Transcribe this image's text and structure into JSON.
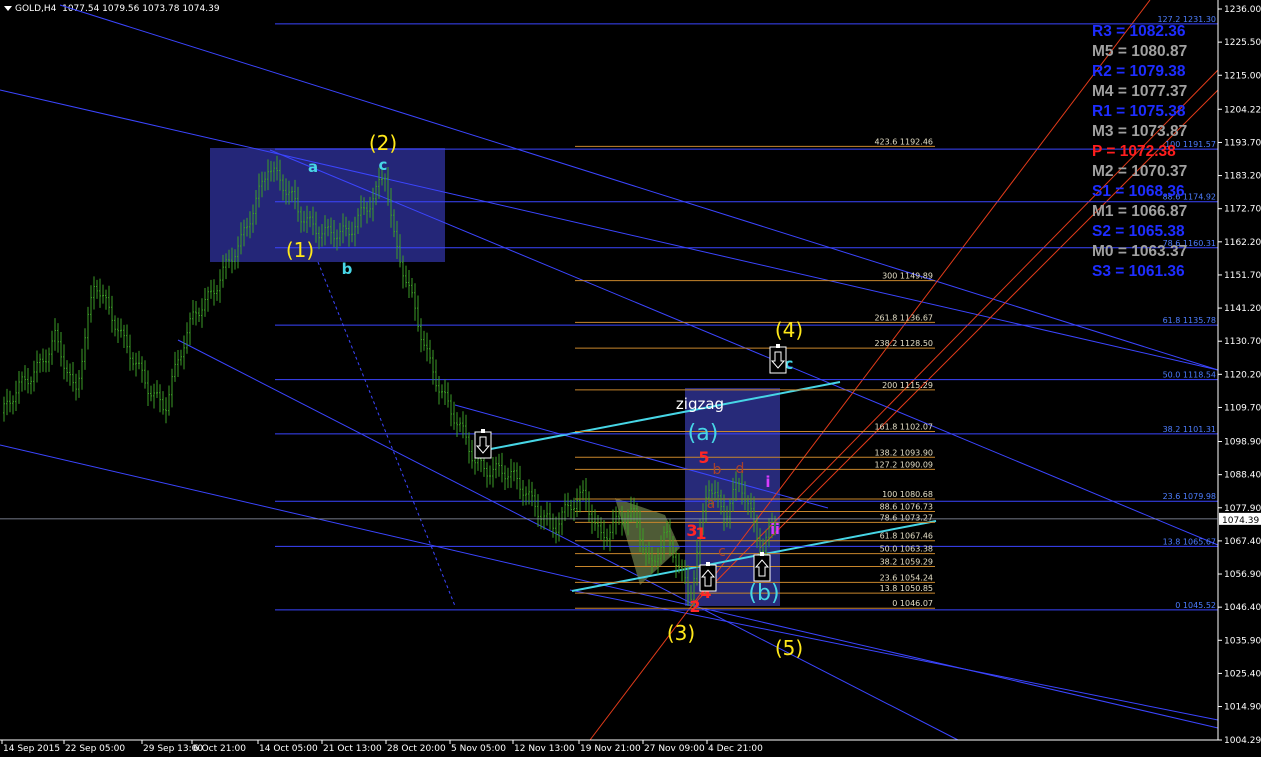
{
  "header": {
    "symbol": "GOLD,H4",
    "ohlc": "1077.54 1079.56 1073.78 1074.39"
  },
  "colors": {
    "background": "#000000",
    "candle": "#3c9d27",
    "trendline": "#3b45ff",
    "fibo": "#c8862c",
    "channel": "#e23b1a",
    "cyan": "#47d6e6",
    "yellow": "#ffe81a",
    "red": "#ff2626",
    "magenta": "#d83cff"
  },
  "chart_data": {
    "type": "candlestick",
    "title": "GOLD,H4",
    "current_price": "1074.39",
    "yaxis": {
      "min": 1004.29,
      "max": 1236.0,
      "ticks": [
        "1236.00",
        "1225.50",
        "1215.00",
        "1204.22",
        "1193.70",
        "1183.20",
        "1172.70",
        "1162.20",
        "1151.70",
        "1141.20",
        "1130.70",
        "1120.20",
        "1109.70",
        "1098.90",
        "1088.40",
        "1077.90",
        "1067.40",
        "1056.90",
        "1046.40",
        "1035.90",
        "1025.40",
        "1014.90",
        "1004.29"
      ]
    },
    "xaxis": {
      "ticks": [
        "14 Sep 2015",
        "22 Sep 05:00",
        "29 Sep 13:00",
        "6 Oct 21:00",
        "14 Oct 05:00",
        "21 Oct 13:00",
        "28 Oct 20:00",
        "5 Nov 05:00",
        "12 Nov 13:00",
        "19 Nov 21:00",
        "27 Nov 09:00",
        "4 Dec 21:00"
      ]
    },
    "pivots": [
      {
        "label": "R3 = 1082.36",
        "color": "#1e2dff"
      },
      {
        "label": "M5 = 1080.87",
        "color": "#a0a0a0"
      },
      {
        "label": "R2 = 1079.38",
        "color": "#1e2dff"
      },
      {
        "label": "M4 = 1077.37",
        "color": "#a0a0a0"
      },
      {
        "label": "R1 = 1075.38",
        "color": "#1e2dff"
      },
      {
        "label": "M3 = 1073.87",
        "color": "#a0a0a0"
      },
      {
        "label": "P = 1072.38",
        "color": "#ff1e1e"
      },
      {
        "label": "M2 = 1070.37",
        "color": "#a0a0a0"
      },
      {
        "label": "S1 = 1068.36",
        "color": "#1e2dff"
      },
      {
        "label": "M1 = 1066.87",
        "color": "#a0a0a0"
      },
      {
        "label": "S2 = 1065.38",
        "color": "#1e2dff"
      },
      {
        "label": "M0 = 1063.37",
        "color": "#a0a0a0"
      },
      {
        "label": "S3 = 1061.36",
        "color": "#1e2dff"
      }
    ],
    "fibo_blue": [
      {
        "label": "127.2 1231.30",
        "price": 1231.3
      },
      {
        "label": "100 1191.57",
        "price": 1191.57
      },
      {
        "label": "88.6 1174.92",
        "price": 1174.92
      },
      {
        "label": "78.6 1160.31",
        "price": 1160.31
      },
      {
        "label": "61.8 1135.78",
        "price": 1135.78
      },
      {
        "label": "50.0 1118.54",
        "price": 1118.54
      },
      {
        "label": "38.2 1101.31",
        "price": 1101.31
      },
      {
        "label": "23.6 1079.98",
        "price": 1079.98
      },
      {
        "label": "13.8 1065.67",
        "price": 1065.67
      },
      {
        "label": "0 1045.52",
        "price": 1045.52
      }
    ],
    "fibo_orange": [
      {
        "label": "423.6 1192.46",
        "price": 1192.46
      },
      {
        "label": "300 1149.89",
        "price": 1149.89
      },
      {
        "label": "261.8 1136.67",
        "price": 1136.67
      },
      {
        "label": "238.2 1128.50",
        "price": 1128.5
      },
      {
        "label": "200 1115.29",
        "price": 1115.29
      },
      {
        "label": "161.8 1102.07",
        "price": 1102.07
      },
      {
        "label": "138.2 1093.90",
        "price": 1093.9
      },
      {
        "label": "127.2 1090.09",
        "price": 1090.09
      },
      {
        "label": "100 1080.68",
        "price": 1080.68
      },
      {
        "label": "88.6 1076.73",
        "price": 1076.73
      },
      {
        "label": "78.6 1073.27",
        "price": 1073.27
      },
      {
        "label": "61.8 1067.46",
        "price": 1067.46
      },
      {
        "label": "50.0 1063.38",
        "price": 1063.38
      },
      {
        "label": "38.2 1059.29",
        "price": 1059.29
      },
      {
        "label": "23.6 1054.24",
        "price": 1054.24
      },
      {
        "label": "13.8 1050.85",
        "price": 1050.85
      },
      {
        "label": "0 1046.07",
        "price": 1046.07
      }
    ],
    "wave_labels": [
      {
        "text": "(1)",
        "color": "yellow"
      },
      {
        "text": "(2)",
        "color": "yellow"
      },
      {
        "text": "(3)",
        "color": "yellow"
      },
      {
        "text": "(4)",
        "color": "yellow"
      },
      {
        "text": "(5)",
        "color": "yellow"
      },
      {
        "text": "a",
        "color": "cyan"
      },
      {
        "text": "b",
        "color": "cyan"
      },
      {
        "text": "c",
        "color": "cyan"
      },
      {
        "text": "c",
        "color": "cyan"
      },
      {
        "text": "(a)",
        "color": "cyan"
      },
      {
        "text": "(b)",
        "color": "cyan"
      },
      {
        "text": "zigzag",
        "color": "white"
      },
      {
        "text": "1",
        "color": "red"
      },
      {
        "text": "2",
        "color": "red"
      },
      {
        "text": "3",
        "color": "red"
      },
      {
        "text": "4",
        "color": "red"
      },
      {
        "text": "5",
        "color": "red"
      },
      {
        "text": "a",
        "color": "dark-red"
      },
      {
        "text": "b",
        "color": "dark-red"
      },
      {
        "text": "c",
        "color": "dark-red"
      },
      {
        "text": "d",
        "color": "dark-red"
      },
      {
        "text": "i",
        "color": "magenta"
      },
      {
        "text": "ii",
        "color": "magenta"
      }
    ],
    "arrows": [
      {
        "direction": "down"
      },
      {
        "direction": "down"
      },
      {
        "direction": "up"
      },
      {
        "direction": "up"
      }
    ]
  }
}
